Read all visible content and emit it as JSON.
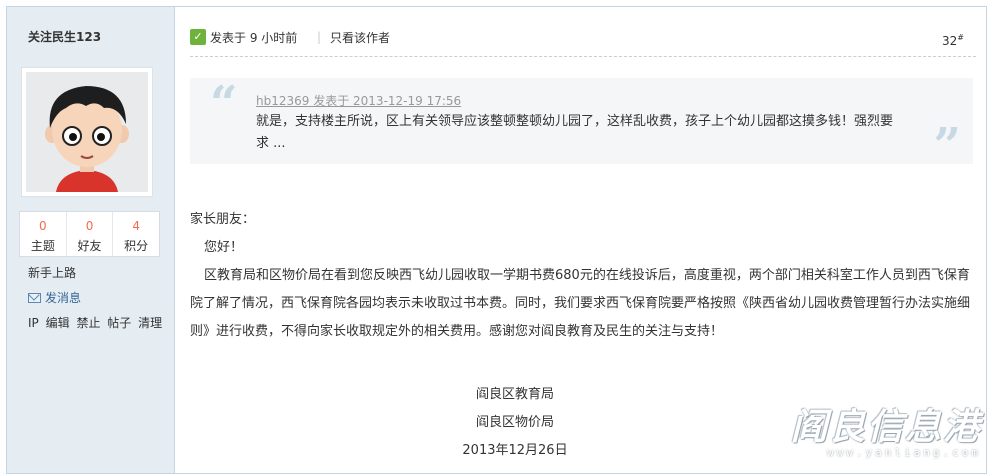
{
  "sidebar": {
    "username": "关注民生123",
    "stats": [
      {
        "value": "0",
        "label": "主题"
      },
      {
        "value": "0",
        "label": "好友"
      },
      {
        "value": "4",
        "label": "积分"
      }
    ],
    "rank": "新手上路",
    "send_message": "发消息",
    "admin_links": [
      "IP",
      "编辑",
      "禁止",
      "帖子",
      "清理"
    ]
  },
  "post": {
    "posted_time": "发表于 9 小时前",
    "separator": "|",
    "author_only": "只看该作者",
    "floor_number": "32",
    "floor_suffix": "#",
    "quote": {
      "author_line": "hb12369 发表于 2013-12-19 17:56",
      "text": "就是，支持楼主所说，区上有关领导应该整顿整顿幼儿园了，这样乱收费，孩子上个幼儿园都这摸多钱！强烈要求 ..."
    },
    "greeting": "家长朋友：",
    "hello": "您好！",
    "body": "区教育局和区物价局在看到您反映西飞幼儿园收取一学期书费680元的在线投诉后，高度重视，两个部门相关科室工作人员到西飞保育院了解了情况，西飞保育院各园均表示未收取过书本费。同时，我们要求西飞保育院要严格按照《陕西省幼儿园收费管理暂行办法实施细则》进行收费，不得向家长收取规定外的相关费用。感谢您对阎良教育及民生的关注与支持！",
    "signature": [
      "阎良区教育局",
      "阎良区物价局",
      "2013年12月26日"
    ]
  },
  "watermark": {
    "cn": "阎良信息港",
    "en": "www.yanliang.com"
  },
  "colors": {
    "sidebar_bg": "#e5edf2",
    "border": "#c2d5e3",
    "stat_number": "#f26c4f",
    "link": "#336699",
    "quote_bg": "#f4f6f8"
  }
}
